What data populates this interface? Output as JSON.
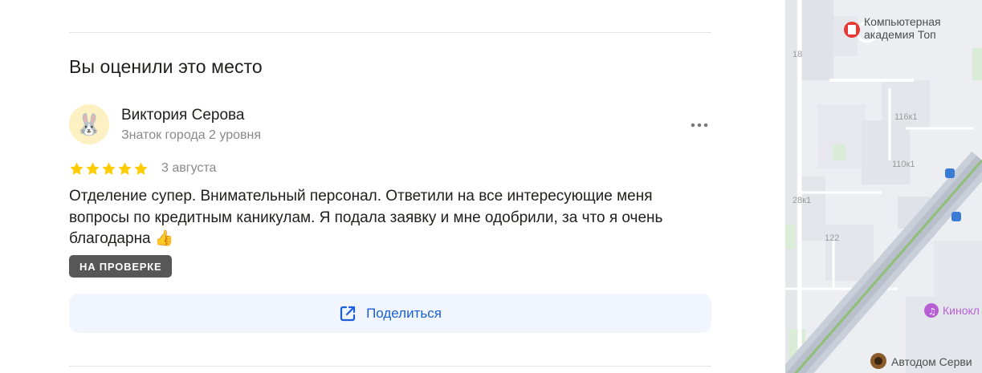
{
  "section": {
    "title": "Вы оценили это место"
  },
  "review": {
    "author": {
      "name": "Виктория Серова",
      "level": "Знаток города 2 уровня",
      "avatar_emoji": "🐰"
    },
    "rating": 5,
    "date": "3 августа",
    "text": "Отделение супер. Внимательный персонал. Ответили на все интересующие меня вопросы по кредитным каникулам. Я подала заявку и мне одобрили, за что я очень благодарна 👍",
    "status": "НА ПРОВЕРКЕ",
    "more_icon": "more-dots-icon"
  },
  "share": {
    "label": "Поделиться",
    "icon": "share-icon"
  },
  "map": {
    "poi": [
      {
        "name": "Компьютерная академия Топ",
        "line1": "Компьютерная",
        "line2": "академия Топ"
      },
      {
        "name": "Кинокл"
      },
      {
        "name": "Автодом Серви"
      }
    ],
    "building_numbers": [
      "18",
      "116к1",
      "110к1",
      "28к1",
      "122"
    ]
  },
  "colors": {
    "accent": "#1a5fd8",
    "star": "#fc0",
    "badge": "#575757",
    "share_bg": "#f1f5fd"
  }
}
